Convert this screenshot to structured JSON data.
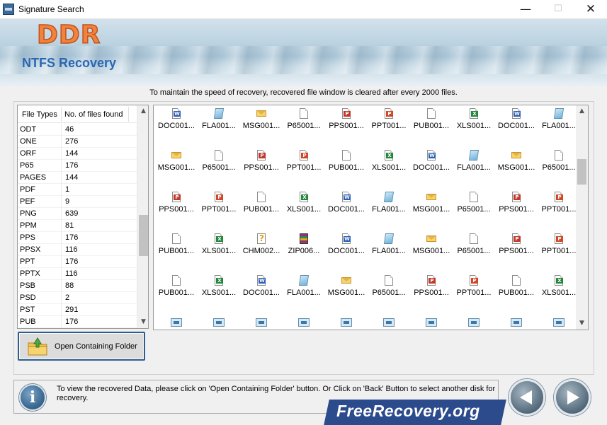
{
  "window": {
    "title": "Signature Search",
    "minimize": "—",
    "maximize": "☐",
    "close": "✕"
  },
  "banner": {
    "brand": "DDR",
    "product": "NTFS Recovery"
  },
  "notice": "To maintain the speed of recovery, recovered file window is cleared after every 2000 files.",
  "file_types": {
    "headers": [
      "File Types",
      "No. of files found"
    ],
    "rows": [
      {
        "type": "ODT",
        "count": "46"
      },
      {
        "type": "ONE",
        "count": "276"
      },
      {
        "type": "ORF",
        "count": "144"
      },
      {
        "type": "P65",
        "count": "176"
      },
      {
        "type": "PAGES",
        "count": "144"
      },
      {
        "type": "PDF",
        "count": "1"
      },
      {
        "type": "PEF",
        "count": "9"
      },
      {
        "type": "PNG",
        "count": "639"
      },
      {
        "type": "PPM",
        "count": "81"
      },
      {
        "type": "PPS",
        "count": "176"
      },
      {
        "type": "PPSX",
        "count": "116"
      },
      {
        "type": "PPT",
        "count": "176"
      },
      {
        "type": "PPTX",
        "count": "116"
      },
      {
        "type": "PSB",
        "count": "88"
      },
      {
        "type": "PSD",
        "count": "2"
      },
      {
        "type": "PST",
        "count": "291"
      },
      {
        "type": "PUB",
        "count": "176"
      }
    ],
    "scroll_position": 0.62
  },
  "open_folder_button": "Open Containing Folder",
  "files": {
    "rows": [
      [
        [
          "DOC001...",
          "doc"
        ],
        [
          "FLA001...",
          "fla"
        ],
        [
          "MSG001...",
          "msg"
        ],
        [
          "P65001...",
          "page"
        ],
        [
          "PPS001...",
          "pps"
        ],
        [
          "PPT001...",
          "ppt"
        ],
        [
          "PUB001...",
          "page"
        ],
        [
          "XLS001...",
          "xls"
        ],
        [
          "DOC001...",
          "doc"
        ],
        [
          "FLA001...",
          "fla"
        ]
      ],
      [
        [
          "MSG001...",
          "msg"
        ],
        [
          "P65001...",
          "page"
        ],
        [
          "PPS001...",
          "pps"
        ],
        [
          "PPT001...",
          "ppt"
        ],
        [
          "PUB001...",
          "page"
        ],
        [
          "XLS001...",
          "xls"
        ],
        [
          "DOC001...",
          "doc"
        ],
        [
          "FLA001...",
          "fla"
        ],
        [
          "MSG001...",
          "msg"
        ],
        [
          "P65001...",
          "page"
        ]
      ],
      [
        [
          "PPS001...",
          "pps"
        ],
        [
          "PPT001...",
          "ppt"
        ],
        [
          "PUB001...",
          "page"
        ],
        [
          "XLS001...",
          "xls"
        ],
        [
          "DOC001...",
          "doc"
        ],
        [
          "FLA001...",
          "fla"
        ],
        [
          "MSG001...",
          "msg"
        ],
        [
          "P65001...",
          "page"
        ],
        [
          "PPS001...",
          "pps"
        ],
        [
          "PPT001...",
          "ppt"
        ]
      ],
      [
        [
          "PUB001...",
          "page"
        ],
        [
          "XLS001...",
          "xls"
        ],
        [
          "CHM002...",
          "chm"
        ],
        [
          "ZIP006...",
          "zip"
        ],
        [
          "DOC001...",
          "doc"
        ],
        [
          "FLA001...",
          "fla"
        ],
        [
          "MSG001...",
          "msg"
        ],
        [
          "P65001...",
          "page"
        ],
        [
          "PPS001...",
          "pps"
        ],
        [
          "PPT001...",
          "ppt"
        ]
      ],
      [
        [
          "PUB001...",
          "page"
        ],
        [
          "XLS001...",
          "xls"
        ],
        [
          "DOC001...",
          "doc"
        ],
        [
          "FLA001...",
          "fla"
        ],
        [
          "MSG001...",
          "msg"
        ],
        [
          "P65001...",
          "page"
        ],
        [
          "PPS001...",
          "pps"
        ],
        [
          "PPT001...",
          "ppt"
        ],
        [
          "PUB001...",
          "page"
        ],
        [
          "XLS001...",
          "xls"
        ]
      ],
      [
        [
          "",
          "img"
        ],
        [
          "",
          "img"
        ],
        [
          "",
          "img"
        ],
        [
          "",
          "img"
        ],
        [
          "",
          "img"
        ],
        [
          "",
          "img"
        ],
        [
          "",
          "img"
        ],
        [
          "",
          "img"
        ],
        [
          "",
          "img"
        ],
        [
          "",
          "img"
        ]
      ]
    ],
    "scroll_position": 0.24
  },
  "status": {
    "message": "To view the recovered Data, please click on 'Open Containing Folder' button. Or Click on 'Back' Button to select another disk for recovery.",
    "info_glyph": "i"
  },
  "watermark": "FreeRecovery.org",
  "nav": {
    "back_icon": "back-arrow-icon",
    "next_icon": "next-arrow-icon"
  },
  "colors": {
    "brand_orange": "#f1833d",
    "product_blue": "#2a67b3",
    "button_border": "#2d5d8f",
    "watermark_bg": "#2c4b8c",
    "doc_badge": "#2b5fb3",
    "xls_badge": "#21873a",
    "ppt_badge": "#d24726",
    "pps_badge": "#c0392b"
  }
}
